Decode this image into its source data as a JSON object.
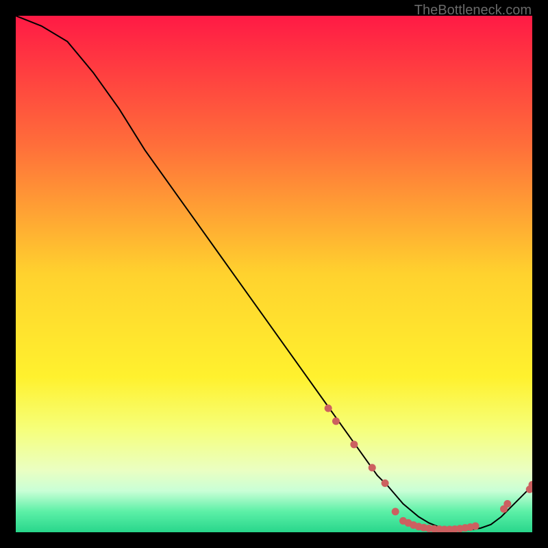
{
  "watermark": "TheBottleneck.com",
  "chart_data": {
    "type": "line",
    "title": "",
    "xlabel": "",
    "ylabel": "",
    "xlim": [
      0,
      100
    ],
    "ylim": [
      0,
      100
    ],
    "curve": {
      "x": [
        0,
        5,
        10,
        15,
        20,
        25,
        30,
        35,
        40,
        45,
        50,
        55,
        60,
        65,
        70,
        72,
        75,
        78,
        80,
        82,
        85,
        88,
        90,
        92,
        94,
        96,
        98,
        100
      ],
      "y": [
        100,
        98,
        95,
        89,
        82,
        74,
        67,
        60,
        53,
        46,
        39,
        32,
        25,
        18,
        11,
        9,
        5.5,
        3,
        1.8,
        1,
        0.5,
        0.5,
        0.8,
        1.5,
        3,
        5,
        7,
        9
      ]
    },
    "markers": [
      {
        "x": 60.5,
        "y": 24
      },
      {
        "x": 62,
        "y": 21.5
      },
      {
        "x": 65.5,
        "y": 17
      },
      {
        "x": 69,
        "y": 12.5
      },
      {
        "x": 71.5,
        "y": 9.5
      },
      {
        "x": 73.5,
        "y": 4
      },
      {
        "x": 75,
        "y": 2.2
      },
      {
        "x": 76,
        "y": 1.8
      },
      {
        "x": 77,
        "y": 1.4
      },
      {
        "x": 78,
        "y": 1.1
      },
      {
        "x": 79,
        "y": 0.9
      },
      {
        "x": 80,
        "y": 0.75
      },
      {
        "x": 81,
        "y": 0.65
      },
      {
        "x": 82,
        "y": 0.6
      },
      {
        "x": 83,
        "y": 0.55
      },
      {
        "x": 84,
        "y": 0.55
      },
      {
        "x": 85,
        "y": 0.6
      },
      {
        "x": 86,
        "y": 0.7
      },
      {
        "x": 87,
        "y": 0.85
      },
      {
        "x": 88,
        "y": 1.0
      },
      {
        "x": 89,
        "y": 1.2
      },
      {
        "x": 94.5,
        "y": 4.5
      },
      {
        "x": 95.2,
        "y": 5.5
      },
      {
        "x": 99.5,
        "y": 8.3
      },
      {
        "x": 100,
        "y": 9.2
      }
    ],
    "gradient_stops": [
      {
        "offset": 0,
        "color": "#ff1a45"
      },
      {
        "offset": 0.25,
        "color": "#ff6e3a"
      },
      {
        "offset": 0.5,
        "color": "#ffd22e"
      },
      {
        "offset": 0.7,
        "color": "#fff12e"
      },
      {
        "offset": 0.8,
        "color": "#f6ff7a"
      },
      {
        "offset": 0.88,
        "color": "#eaffc2"
      },
      {
        "offset": 0.92,
        "color": "#c9ffd6"
      },
      {
        "offset": 0.96,
        "color": "#5cf0a7"
      },
      {
        "offset": 1.0,
        "color": "#28d68b"
      }
    ],
    "marker_color": "#cc6060",
    "line_color": "#000000"
  }
}
